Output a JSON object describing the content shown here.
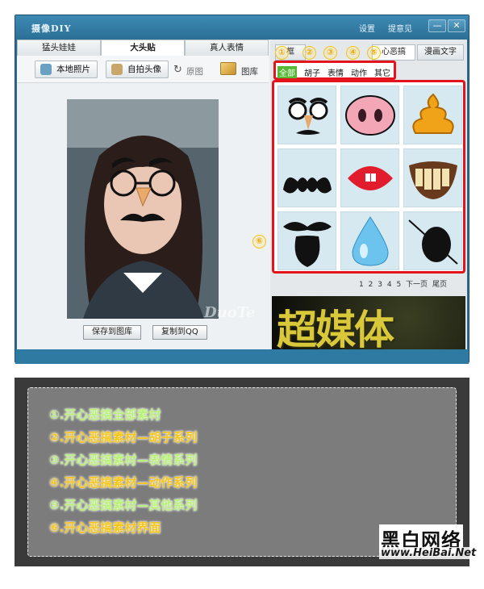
{
  "window": {
    "title": "摄像DIY",
    "links": [
      "设置",
      "提意见"
    ],
    "minimize": "—",
    "close": "✕"
  },
  "left_tabs": [
    "猛头娃娃",
    "大头贴",
    "真人表情"
  ],
  "toolbar": {
    "local_photo": "本地照片",
    "selfie": "自拍头像",
    "original": "原图",
    "gallery": "图库"
  },
  "photo_actions": {
    "save_to_gallery": "保存到图库",
    "copy_to_qq": "复制到QQ"
  },
  "right_tabs": [
    "框",
    "心恶搞",
    "漫画文字"
  ],
  "categories": [
    "全部",
    "胡子",
    "表情",
    "动作",
    "其它"
  ],
  "markers": [
    "①",
    "②",
    "③",
    "④",
    "⑤",
    "⑥"
  ],
  "pager": {
    "pages": [
      "1",
      "2",
      "3",
      "4",
      "5"
    ],
    "next": "下一页",
    "last": "尾页"
  },
  "banner": {
    "text": "超媒体",
    "watermark": "DuoTe"
  },
  "legend": [
    {
      "text": "①.开心恶搞全部素材",
      "color": "#b9f07a"
    },
    {
      "text": "②.开心恶搞素材—胡子系列",
      "color": "#f5c518"
    },
    {
      "text": "③.开心恶搞素材—表情系列",
      "color": "#b9f07a"
    },
    {
      "text": "④.开心恶搞素材—动作系列",
      "color": "#f5c518"
    },
    {
      "text": "⑤.开心恶搞素材—其他系列",
      "color": "#b9f07a"
    },
    {
      "text": "⑥.开心恶搞素材界面",
      "color": "#f5c518"
    }
  ],
  "logo": {
    "name": "黑白网络",
    "url": "www.HeiBai.Net"
  }
}
